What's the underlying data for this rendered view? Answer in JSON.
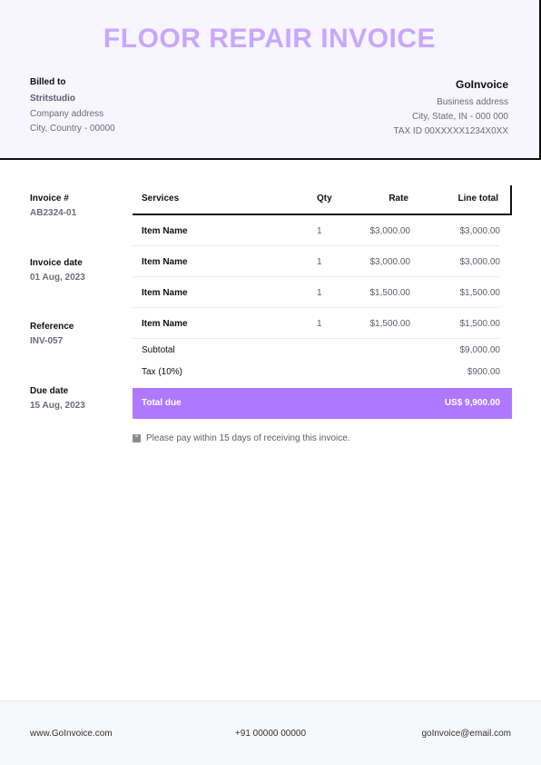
{
  "title": "FLOOR REPAIR INVOICE",
  "billed_to": {
    "label": "Billed to",
    "name": "Stritstudio",
    "address": "Company address",
    "city": "City, Country - 00000"
  },
  "company": {
    "name": "GoInvoice",
    "address": "Business address",
    "city": "City, State, IN - 000 000",
    "tax": "TAX ID 00XXXXX1234X0XX"
  },
  "meta": {
    "invoice_no_label": "Invoice #",
    "invoice_no": "AB2324-01",
    "invoice_date_label": "Invoice date",
    "invoice_date": "01 Aug, 2023",
    "reference_label": "Reference",
    "reference": "INV-057",
    "due_date_label": "Due date",
    "due_date": "15 Aug, 2023"
  },
  "table": {
    "headers": {
      "services": "Services",
      "qty": "Qty",
      "rate": "Rate",
      "line_total": "Line total"
    },
    "rows": [
      {
        "service": "Item Name",
        "qty": "1",
        "rate": "$3,000.00",
        "total": "$3,000.00"
      },
      {
        "service": "Item Name",
        "qty": "1",
        "rate": "$3,000.00",
        "total": "$3,000.00"
      },
      {
        "service": "Item Name",
        "qty": "1",
        "rate": "$1,500.00",
        "total": "$1,500.00"
      },
      {
        "service": "Item Name",
        "qty": "1",
        "rate": "$1,500.00",
        "total": "$1,500.00"
      }
    ],
    "subtotal_label": "Subtotal",
    "subtotal": "$9,000.00",
    "tax_label": "Tax (10%)",
    "tax": "$900.00",
    "total_due_label": "Total due",
    "total_due": "US$ 9,900.00"
  },
  "note": "Please pay within 15 days of receiving this invoice.",
  "footer": {
    "website": "www.GoInvoice.com",
    "phone": "+91 00000 00000",
    "email": "goInvoice@email.com"
  },
  "colors": {
    "title": "#c8a8ff",
    "header_bg": "#f7f5fe",
    "accent": "#b078ff"
  },
  "icons": {
    "note": "info-quote-icon"
  }
}
